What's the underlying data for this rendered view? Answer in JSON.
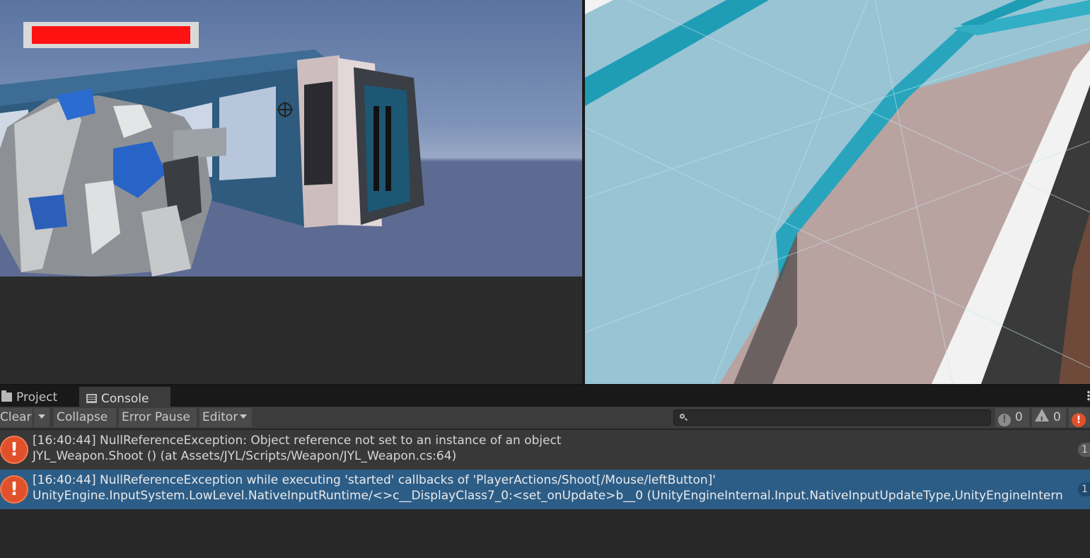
{
  "game": {
    "health_fraction": 1.0
  },
  "tabs": [
    {
      "label": "Project",
      "icon": "folder-icon"
    },
    {
      "label": "Console",
      "icon": "console-icon"
    }
  ],
  "toolbar": {
    "clear_label": "Clear",
    "collapse_label": "Collapse",
    "error_pause_label": "Error Pause",
    "editor_label": "Editor",
    "search_value": "",
    "info_count": "0",
    "warning_count": "0",
    "error_count": ""
  },
  "logs": [
    {
      "line1": "[16:40:44] NullReferenceException: Object reference not set to an instance of an object",
      "line2": "JYL_Weapon.Shoot () (at Assets/JYL/Scripts/Weapon/JYL_Weapon.cs:64)",
      "count": "1",
      "selected": false
    },
    {
      "line1": "[16:40:44] NullReferenceException while executing 'started' callbacks of 'PlayerActions/Shoot[/Mouse/leftButton]'",
      "line2": "UnityEngine.InputSystem.LowLevel.NativeInputRuntime/<>c__DisplayClass7_0:<set_onUpdate>b__0 (UnityEngineInternal.Input.NativeInputUpdateType,UnityEngineIntern",
      "count": "1",
      "selected": true
    }
  ],
  "colors": {
    "health_fill": "#ff1212",
    "error_icon": "#e0502a",
    "selected_row": "#2c5d87"
  }
}
